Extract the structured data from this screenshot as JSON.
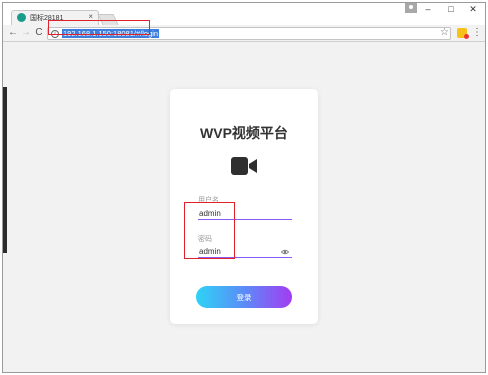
{
  "browser": {
    "tab_title": "国标28181",
    "tab_close": "×",
    "url": "192.168.1.150:18081/#/login",
    "window_controls": {
      "minimize": "–",
      "maximize": "□",
      "close": "✕"
    },
    "nav": {
      "back": "←",
      "forward": "→",
      "reload": "C"
    },
    "star": "☆",
    "menu": "⋮",
    "info": "i"
  },
  "login": {
    "title": "WVP视频平台",
    "username_label": "用户名",
    "username_value": "admin",
    "password_label": "密码",
    "password_value": "admin",
    "submit_label": "登录"
  },
  "colors": {
    "highlight": "#e0202a",
    "accent_underline": "#8a5cf5",
    "button_gradient": [
      "#2ed3f5",
      "#a33cf2"
    ]
  }
}
